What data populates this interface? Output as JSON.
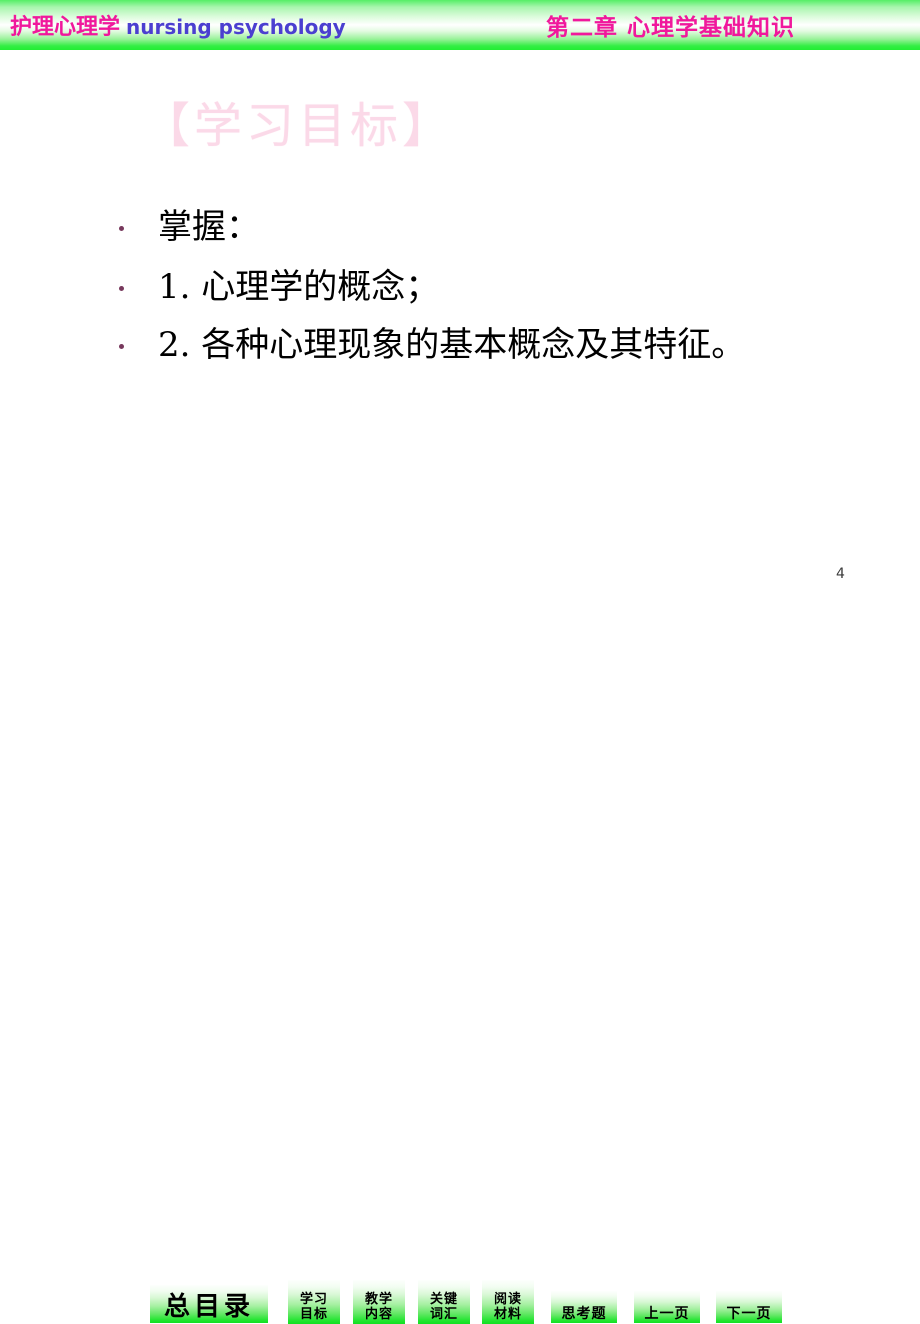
{
  "header": {
    "left_title_cn": "护理心理学",
    "left_title_en": "nursing psychology",
    "right_title": "第二章  心理学基础知识",
    "colors": {
      "chinese": "#f0189c",
      "english": "#4b3fd0",
      "band_green": "#22ee33"
    }
  },
  "slide": {
    "title": "【学习目标】",
    "title_color": "#fbd9e8",
    "bullets": [
      {
        "text": "掌握：",
        "dot_color": "#77385c"
      },
      {
        "text": "1. 心理学的概念；",
        "dot_color": "#77385c"
      },
      {
        "text": "2. 各种心理现象的基本概念及其特征。",
        "dot_color": "#77385c"
      }
    ],
    "page_number": "4"
  },
  "nav": {
    "main_button": {
      "label": "总目录"
    },
    "two_line_buttons": [
      {
        "line1": "学习",
        "line2": "目标"
      },
      {
        "line1": "教学",
        "line2": "内容"
      },
      {
        "line1": "关键",
        "line2": "词汇"
      },
      {
        "line1": "阅读",
        "line2": "材料"
      }
    ],
    "one_line_buttons": [
      {
        "label": "思考题"
      },
      {
        "label": "上一页"
      },
      {
        "label": "下一页"
      }
    ]
  }
}
